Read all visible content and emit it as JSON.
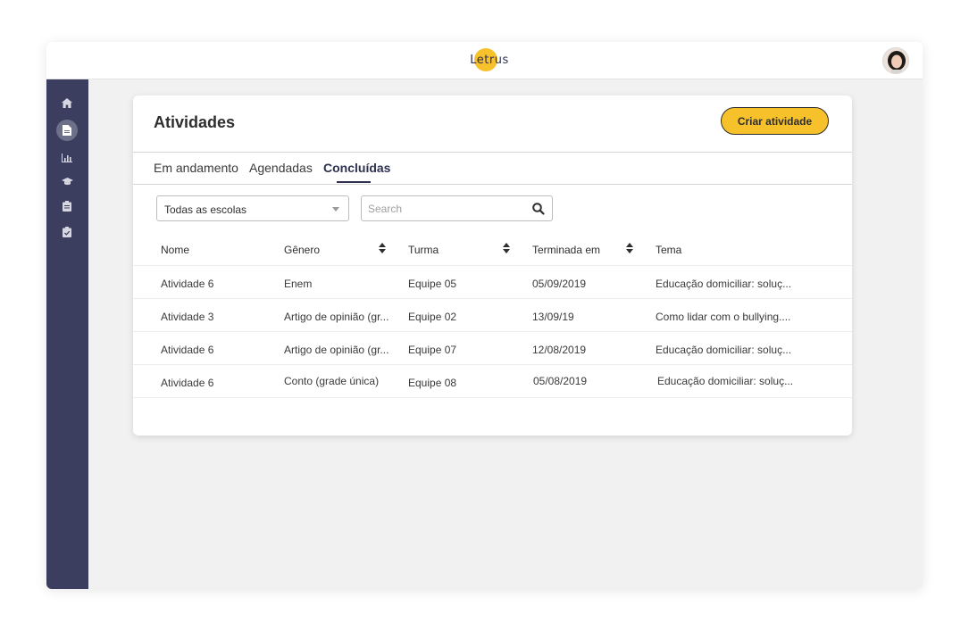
{
  "topbar": {
    "logo_text": "Letrus"
  },
  "sidebar": {
    "items": [
      {
        "icon": "home-icon"
      },
      {
        "icon": "document-icon"
      },
      {
        "icon": "chart-icon"
      },
      {
        "icon": "graduation-cap-icon"
      },
      {
        "icon": "clipboard-icon"
      },
      {
        "icon": "clipboard-check-icon"
      }
    ]
  },
  "page": {
    "title": "Atividades",
    "create_button": "Criar atividade",
    "tabs": [
      {
        "label": "Em andamento",
        "active": false
      },
      {
        "label": "Agendadas",
        "active": false
      },
      {
        "label": "Concluídas",
        "active": true
      }
    ]
  },
  "filters": {
    "school_select": "Todas as escolas",
    "search_placeholder": "Search"
  },
  "table": {
    "columns": [
      "Nome",
      "Gênero",
      "Turma",
      "Terminada em",
      "Tema"
    ],
    "rows": [
      [
        "Atividade 6",
        "Enem",
        "Equipe 05",
        "05/09/2019",
        "Educação domiciliar: soluç..."
      ],
      [
        "Atividade 3",
        "Artigo de opinião (gr...",
        "Equipe 02",
        "13/09/19",
        "Como lidar com o bullying...."
      ],
      [
        "Atividade 6",
        "Artigo de opinião (gr...",
        "Equipe 07",
        "12/08/2019",
        "Educação domiciliar: soluç..."
      ],
      [
        "Atividade 6",
        "Conto (grade única)",
        "Equipe 08",
        "05/08/2019",
        "Educação domiciliar: soluç..."
      ]
    ]
  },
  "colors": {
    "accent": "#f6c12b",
    "sidebar": "#3b3e5e",
    "primary_text": "#2e3150"
  }
}
